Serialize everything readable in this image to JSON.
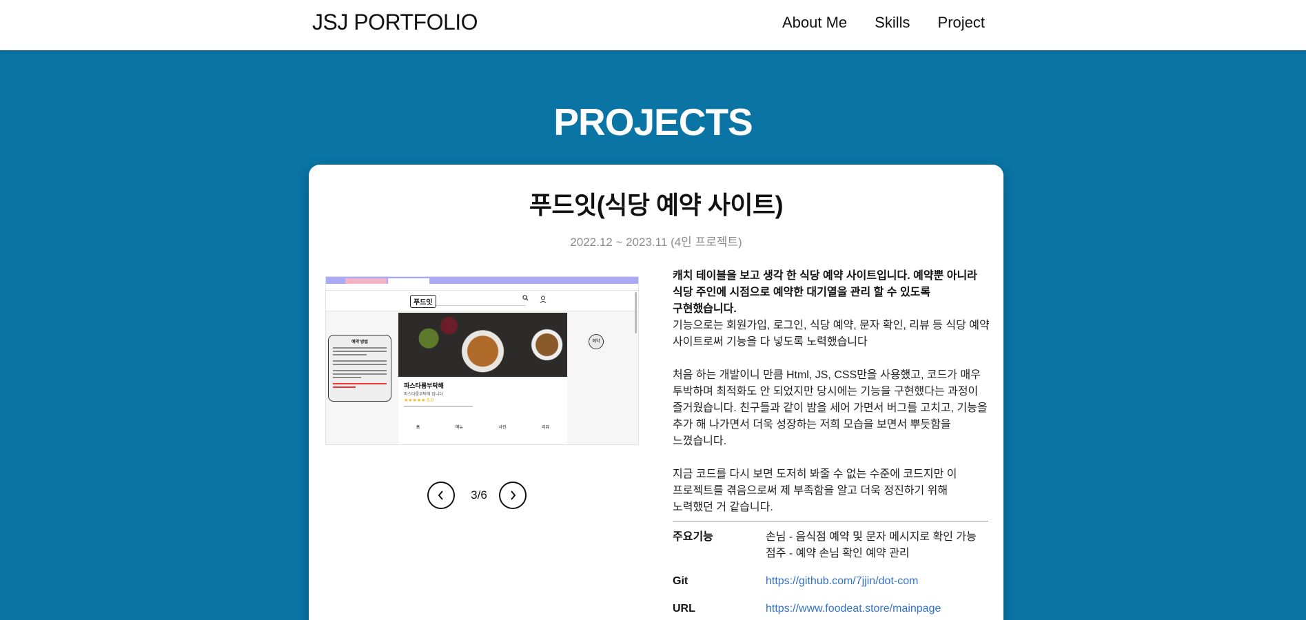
{
  "header": {
    "brand": "JSJ PORTFOLIO",
    "nav": [
      "About Me",
      "Skills",
      "Project"
    ]
  },
  "section": {
    "title": "PROJECTS"
  },
  "project": {
    "title": "푸드잇(식당 예약 사이트)",
    "period": "2022.12 ~ 2023.11 (4인 프로젝트)",
    "screenshot": {
      "logo": "푸드잇",
      "restaurant_name": "파스타룸부탁해",
      "restaurant_sub": "파스타룸부탁해 입니다",
      "rating": "★★★★★ 5.0",
      "side_title": "예약 방법",
      "side_button": "예약",
      "tabs": [
        "홈",
        "메뉴",
        "사진",
        "리뷰"
      ]
    },
    "pager": {
      "current": "3/6"
    },
    "description": {
      "p1_bold": "캐치 테이블을 보고 생각 한 식당 예약 사이트입니다. 예약뿐 아니라 식당 주인에 시점으로 예약한 대기열을 관리 할 수 있도록 구현했습니다.",
      "p1_normal": "기능으로는 회원가입, 로그인, 식당 예약, 문자 확인, 리뷰 등 식당 예약 사이트로써 기능을 다 넣도록 노력했습니다",
      "p2": "처음 하는 개발이니 만큼 Html, JS, CSS만을 사용했고, 코드가 매우 투박하며 최적화도 안 되었지만 당시에는 기능을 구현했다는 과정이 즐거웠습니다. 친구들과 같이 밤을 세어 가면서 버그를 고치고, 기능을 추가 해 나가면서 더욱 성장하는 저희 모습을 보면서 뿌듯함을 느꼈습니다.",
      "p3": "지금 코드를 다시 보면 도저히 봐줄 수 없는 수준에 코드지만 이 프로젝트를 겪음으로써 제 부족함을 알고 더욱 정진하기 위해 노력했던 거 같습니다."
    },
    "meta": {
      "features_label": "주요기능",
      "features": [
        "손님 - 음식점 예약 및 문자 메시지로 확인 가능",
        "점주 - 예약 손님 확인 예약 관리"
      ],
      "git_label": "Git",
      "git_url": "https://github.com/7jjin/dot-com",
      "url_label": "URL",
      "site_url": "https://www.foodeat.store/mainpage"
    }
  },
  "colors": {
    "background": "#0a74a5",
    "link": "#3071c9"
  }
}
